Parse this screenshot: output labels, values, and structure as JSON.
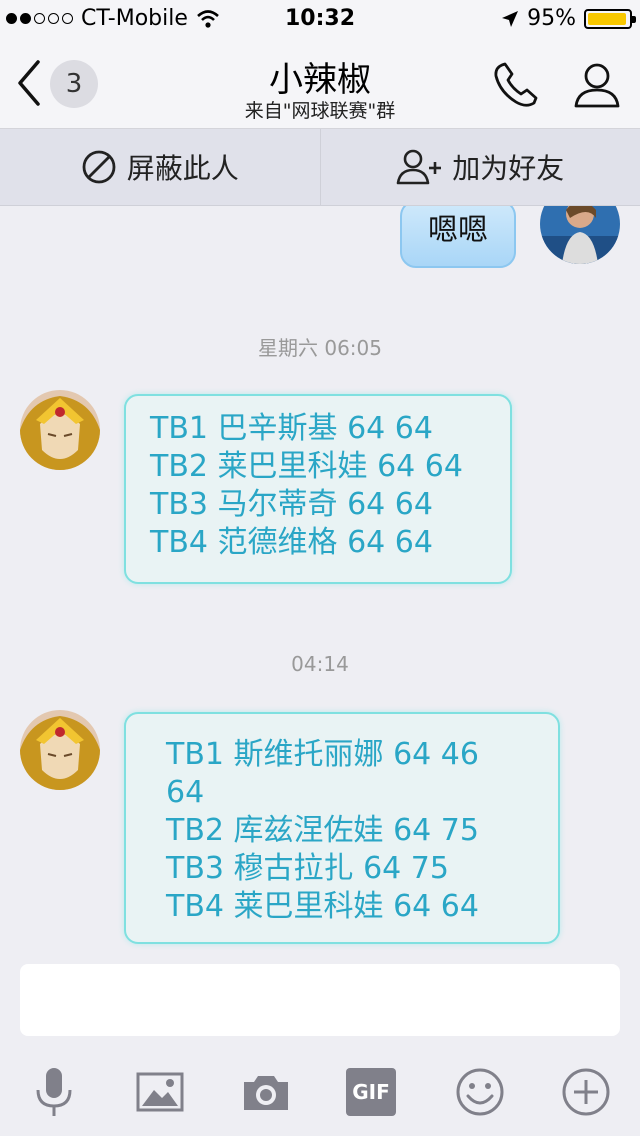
{
  "status": {
    "carrier": "CT-Mobile",
    "time": "10:32",
    "battery": "95%",
    "battery_level": 0.95,
    "signal_full_dots": 2,
    "signal_total_dots": 5
  },
  "header": {
    "unread_count": "3",
    "title": "小辣椒",
    "subtitle": "来自\"网球联赛\"群"
  },
  "actions": {
    "block": "屏蔽此人",
    "add_friend": "加为好友"
  },
  "messages": [
    {
      "type": "out",
      "text": "嗯嗯"
    },
    {
      "type": "time",
      "text": "星期六 06:05"
    },
    {
      "type": "in",
      "lines": [
        "TB1 巴辛斯基 64 64",
        "TB2 莱巴里科娃 64 64",
        "TB3 马尔蒂奇 64 64",
        "TB4 范德维格 64 64"
      ]
    },
    {
      "type": "time",
      "text": "04:14"
    },
    {
      "type": "in",
      "lines": [
        "TB1  斯维托丽娜 64 46",
        "64",
        "TB2 库兹涅佐娃 64 75",
        "TB3 穆古拉扎 64 75",
        "TB4 莱巴里科娃 64 64"
      ]
    }
  ],
  "toolbar": {
    "gif": "GIF",
    "icons": [
      "microphone-icon",
      "image-icon",
      "camera-icon",
      "gif-icon",
      "emoji-icon",
      "plus-icon"
    ]
  },
  "colors": {
    "incoming_text": "#2aa6c6",
    "incoming_border": "#7fe0e0",
    "outgoing_bubble": "#a9d6f7",
    "battery_fill": "#f8c800"
  }
}
